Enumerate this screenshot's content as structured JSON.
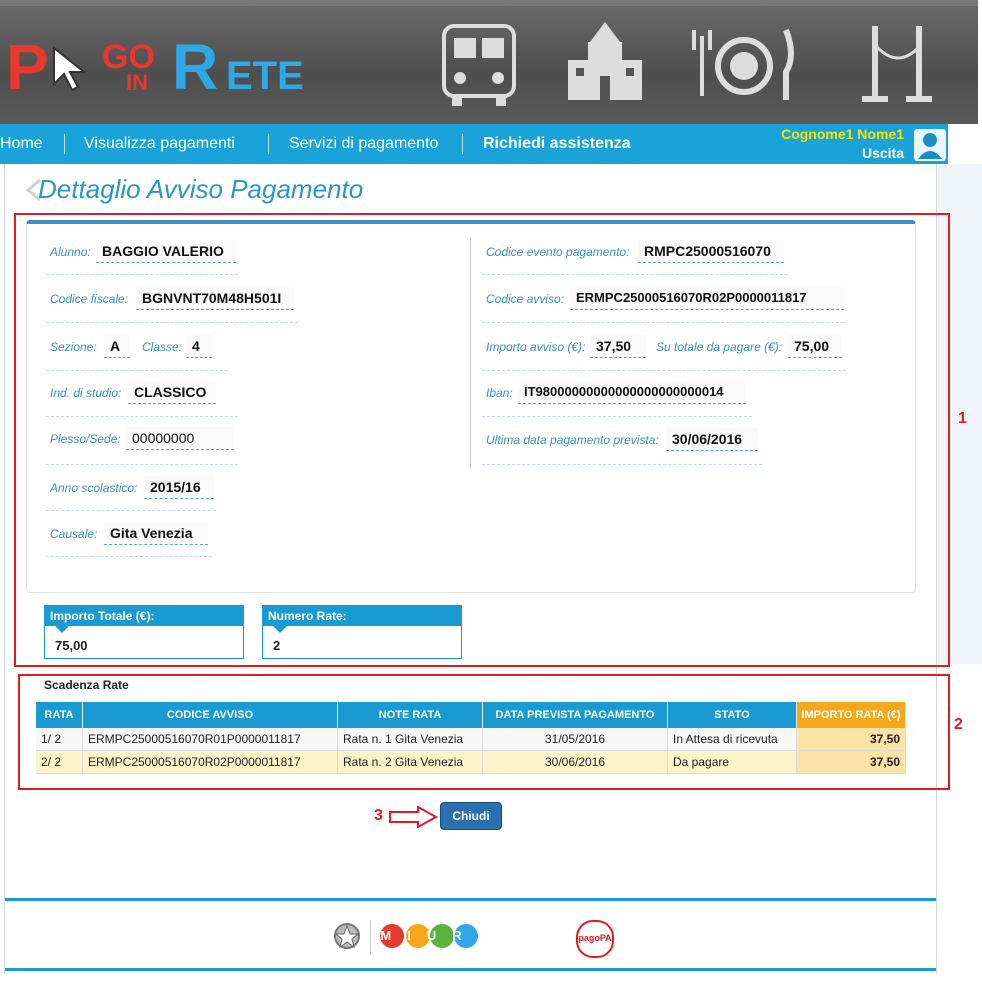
{
  "brand": {
    "logo_text": "PAGO IN RETE"
  },
  "nav": {
    "items": [
      {
        "label": "Home"
      },
      {
        "label": "Visualizza pagamenti"
      },
      {
        "label": "Servizi di pagamento"
      },
      {
        "label": "Richiedi assistenza"
      }
    ],
    "user_name": "Cognome1 Nome1",
    "exit_label": "Uscita"
  },
  "page": {
    "title": "Dettaglio Avviso Pagamento"
  },
  "details": {
    "alunno_label": "Alunno:",
    "alunno": "BAGGIO VALERIO",
    "cf_label": "Codice fiscale:",
    "cf": "BGNVNT70M48H501I",
    "sezione_label": "Sezione:",
    "sezione": "A",
    "classe_label": "Classe:",
    "classe": "4",
    "indirizzo_label": "Ind. di studio:",
    "indirizzo": "CLASSICO",
    "plesso_label": "Plesso/Sede:",
    "plesso": "00000000",
    "anno_label": "Anno scolastico:",
    "anno": "2015/16",
    "causale_label": "Causale:",
    "causale": "Gita Venezia",
    "evento_label": "Codice evento pagamento:",
    "evento": "RMPC25000516070",
    "avviso_label": "Codice avviso:",
    "avviso": "ERMPC25000516070R02P0000011817",
    "importo_label": "Importo avviso (€):",
    "importo": "37,50",
    "su_totale_label": "Su totale da pagare (€):",
    "su_totale": "75,00",
    "iban_label": "Iban:",
    "iban": "IT98000000000000000000000014",
    "ultima_label": "Ultima data pagamento prevista:",
    "ultima": "30/06/2016"
  },
  "totals": {
    "importo_totale_label": "Importo Totale (€):",
    "importo_totale": "75,00",
    "numero_rate_label": "Numero Rate:",
    "numero_rate": "2"
  },
  "rates": {
    "section_title": "Scadenza Rate",
    "headers": [
      "RATA",
      "CODICE AVVISO",
      "NOTE RATA",
      "DATA PREVISTA PAGAMENTO",
      "STATO",
      "IMPORTO RATA (€)"
    ],
    "rows": [
      [
        "1/ 2",
        "ERMPC25000516070R01P0000011817",
        "Rata n. 1 Gita Venezia",
        "31/05/2016",
        "In Attesa di ricevuta",
        "37,50"
      ],
      [
        "2/ 2",
        "ERMPC25000516070R02P0000011817",
        "Rata n. 2 Gita Venezia",
        "30/06/2016",
        "Da pagare",
        "37,50"
      ]
    ]
  },
  "actions": {
    "close_label": "Chiudi"
  },
  "annotations": {
    "m1": "1",
    "m2": "2",
    "m3": "3"
  },
  "footer": {
    "miur_text": "MIUR",
    "pagopa_text": "pagoPA"
  },
  "colors": {
    "nav": "#1aa3d8",
    "accent_red": "#e21a22",
    "amount_header": "#f5a81c",
    "button": "#2a6fae"
  }
}
